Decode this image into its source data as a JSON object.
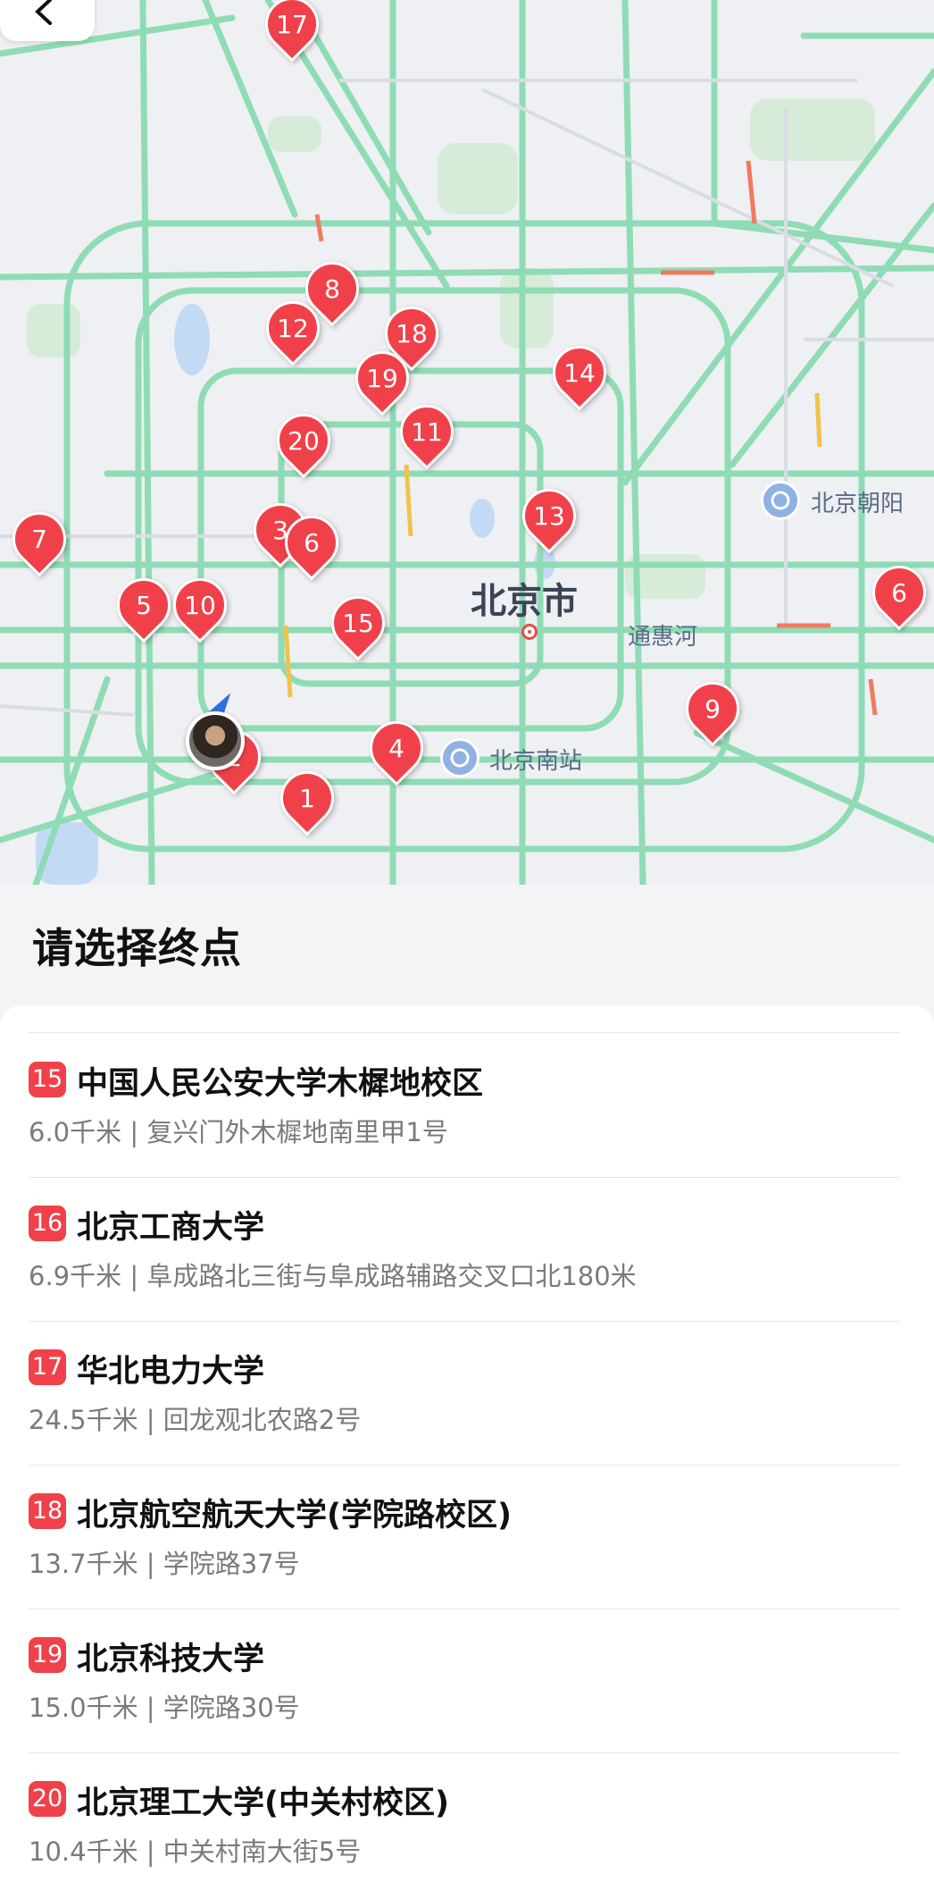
{
  "map": {
    "city_label": "北京市",
    "labels": {
      "chaoyang": "北京朝阳",
      "tonghui_river": "通惠河",
      "south_station": "北京南站"
    },
    "pins": [
      {
        "n": "1"
      },
      {
        "n": "2"
      },
      {
        "n": "3"
      },
      {
        "n": "4"
      },
      {
        "n": "5"
      },
      {
        "n": "6"
      },
      {
        "n": "6"
      },
      {
        "n": "7"
      },
      {
        "n": "8"
      },
      {
        "n": "9"
      },
      {
        "n": "10"
      },
      {
        "n": "11"
      },
      {
        "n": "12"
      },
      {
        "n": "13"
      },
      {
        "n": "14"
      },
      {
        "n": "15"
      },
      {
        "n": "17"
      },
      {
        "n": "18"
      },
      {
        "n": "19"
      },
      {
        "n": "20"
      }
    ],
    "colors": {
      "pin": "#f0414b",
      "road": "#8fdcb4",
      "water": "#c3daf5",
      "park": "#d6ecd8"
    }
  },
  "sheet": {
    "title": "请选择终点"
  },
  "destinations": [
    {
      "badge": "15",
      "name": "中国人民公安大学木樨地校区",
      "detail": "6.0千米 | 复兴门外木樨地南里甲1号"
    },
    {
      "badge": "16",
      "name": "北京工商大学",
      "detail": "6.9千米 | 阜成路北三街与阜成路辅路交叉口北180米"
    },
    {
      "badge": "17",
      "name": "华北电力大学",
      "detail": "24.5千米 | 回龙观北农路2号"
    },
    {
      "badge": "18",
      "name": "北京航空航天大学(学院路校区)",
      "detail": "13.7千米 | 学院路37号"
    },
    {
      "badge": "19",
      "name": "北京科技大学",
      "detail": "15.0千米 | 学院路30号"
    },
    {
      "badge": "20",
      "name": "北京理工大学(中关村校区)",
      "detail": "10.4千米 | 中关村南大街5号"
    }
  ]
}
